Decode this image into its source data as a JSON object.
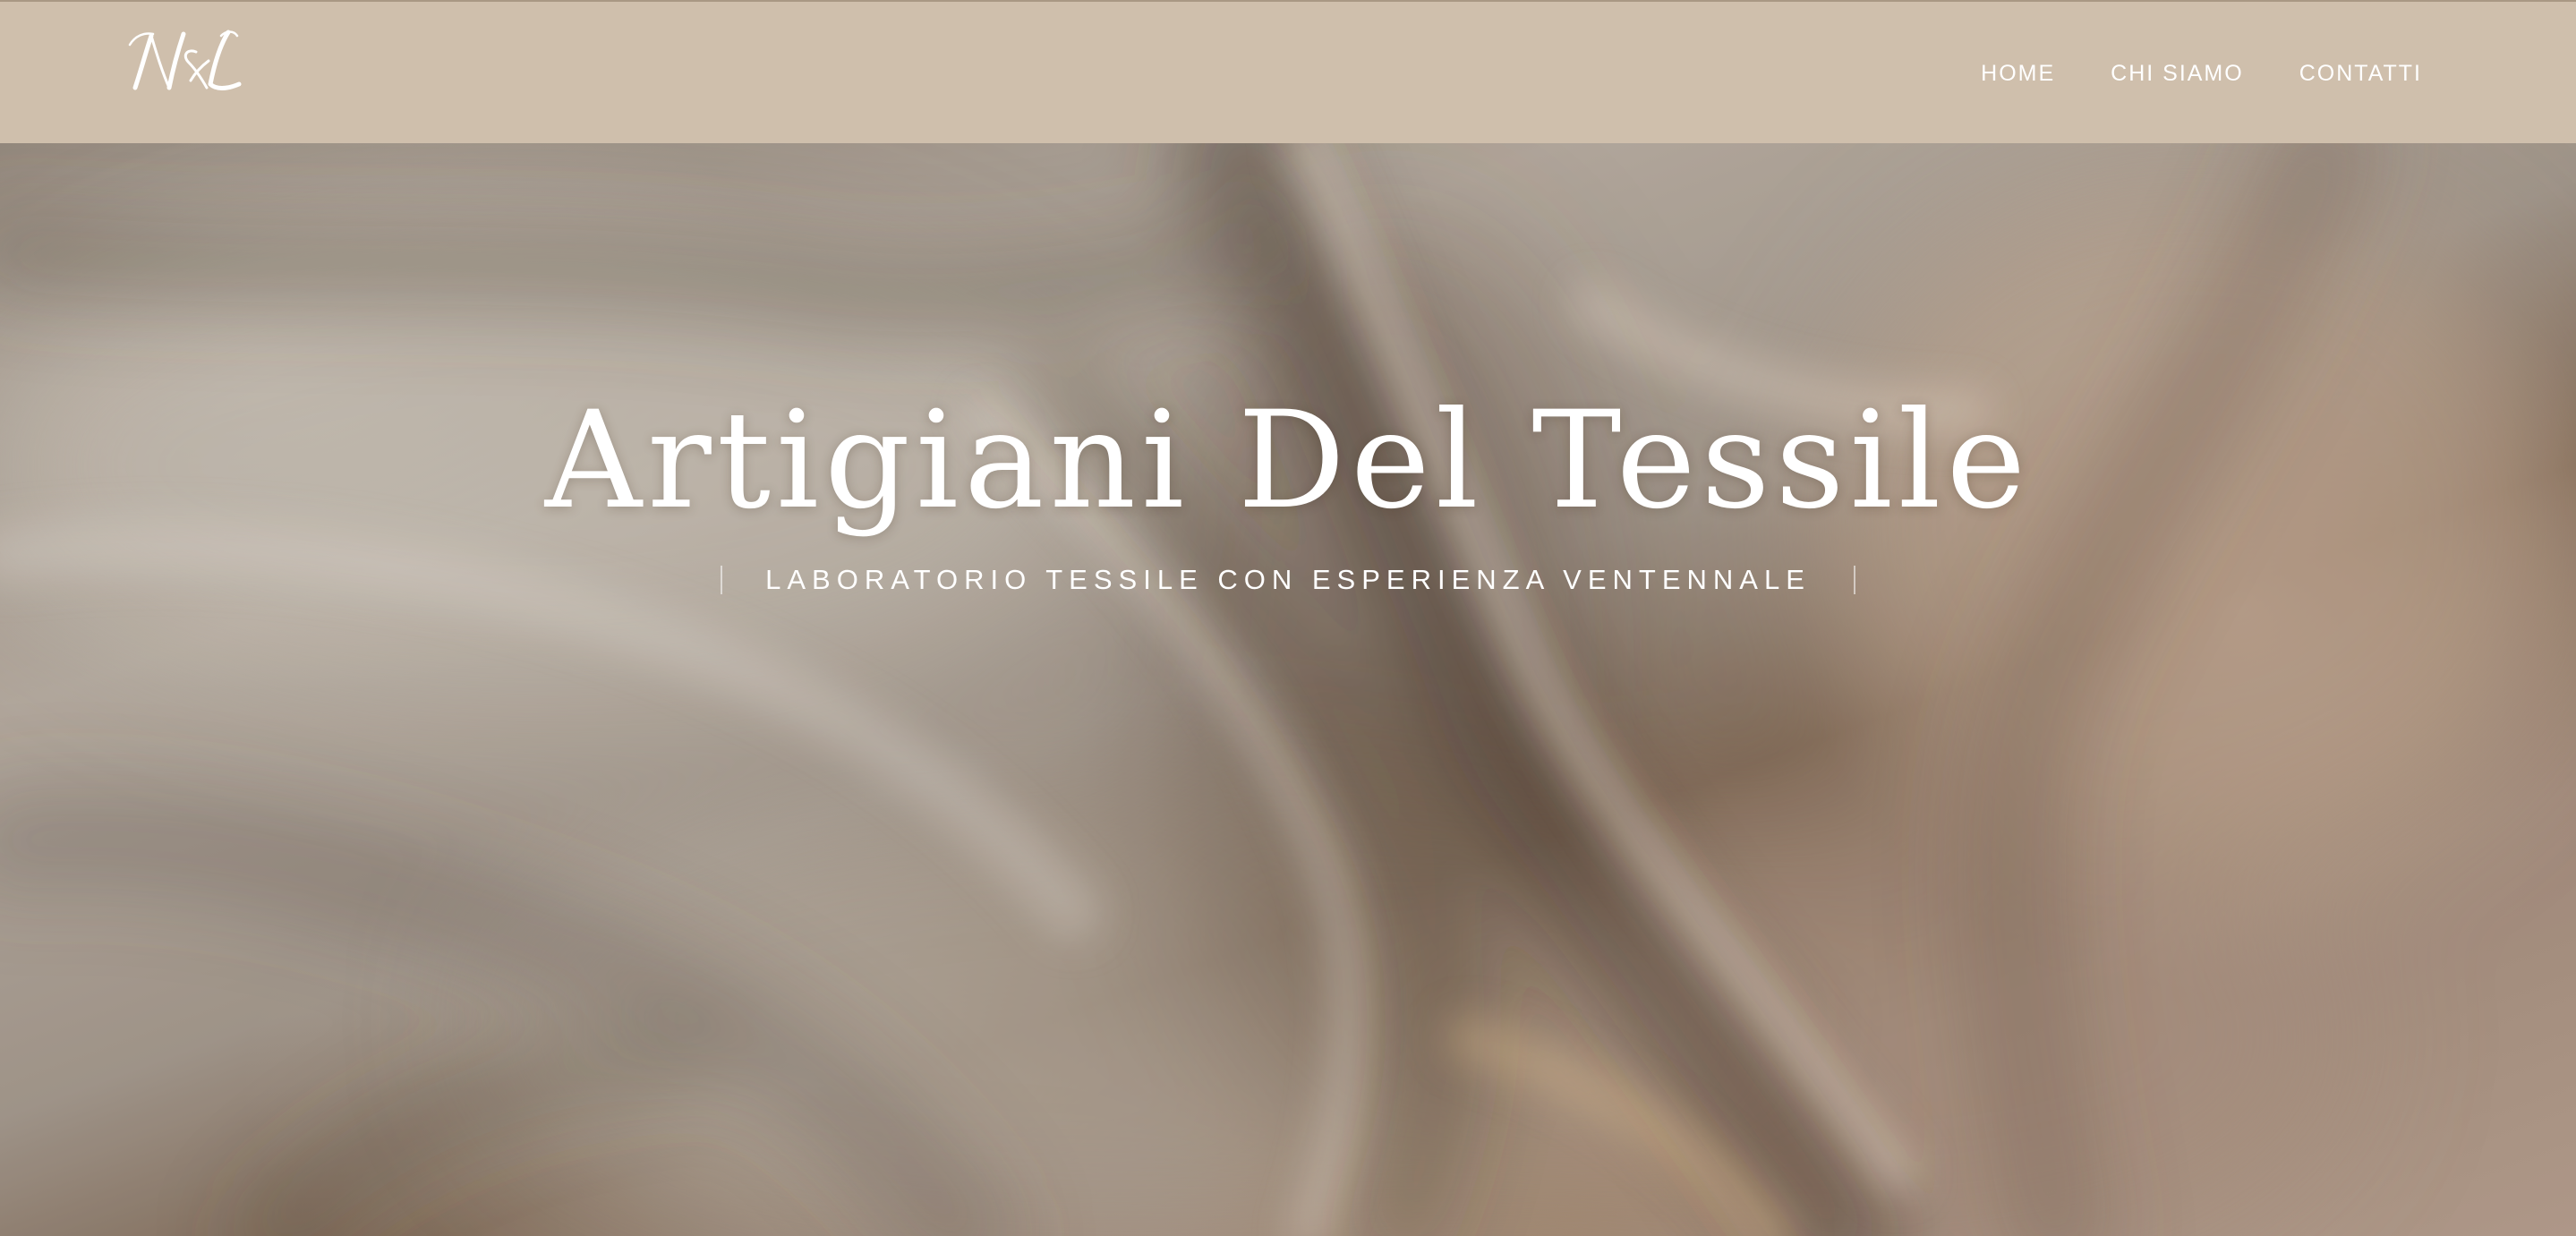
{
  "header": {
    "logo_text": "N&L",
    "nav": [
      {
        "label": "HOME"
      },
      {
        "label": "CHI SIAMO"
      },
      {
        "label": "CONTATTI"
      }
    ],
    "background_color": "#cfbfac"
  },
  "hero": {
    "title": "Artigiani Del Tessile",
    "subtitle": "LABORATORIO TESSILE CON ESPERIENZA VENTENNALE",
    "background": "satin-fabric-photo"
  }
}
